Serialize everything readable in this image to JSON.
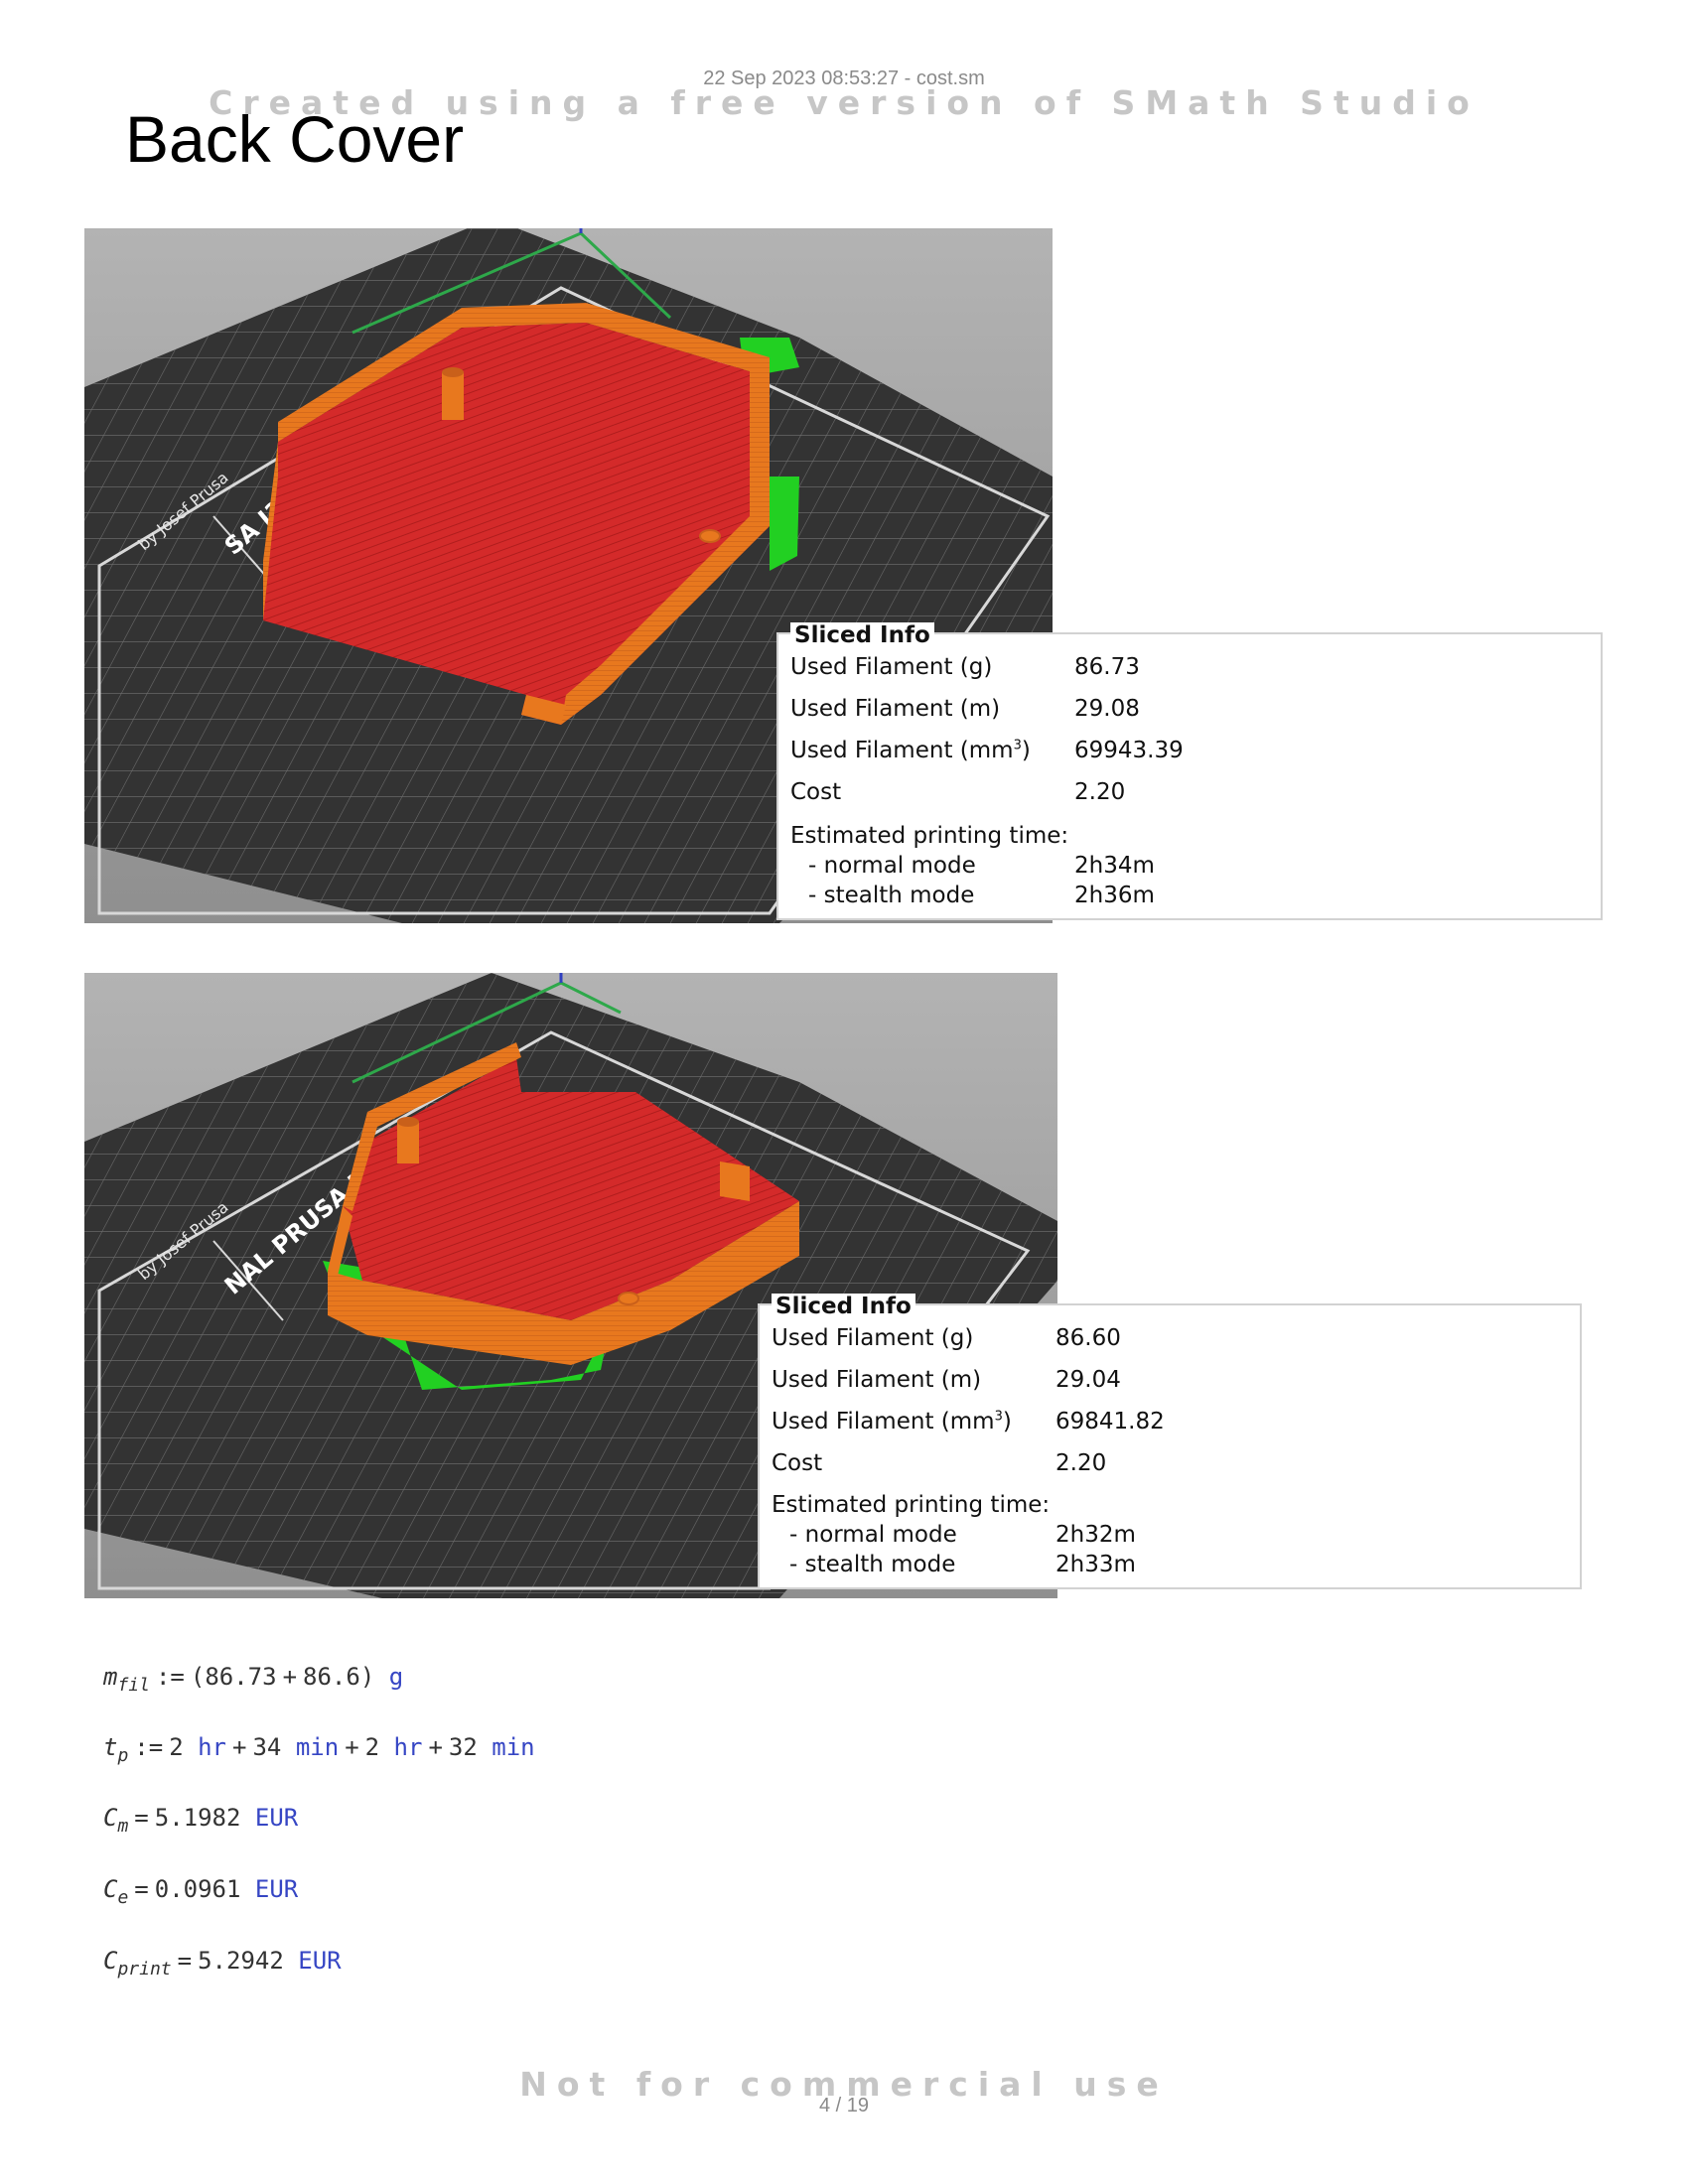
{
  "header": {
    "stamp": "22 Sep 2023 08:53:27 - cost.sm",
    "watermark_top": "Created using a free version of SMath Studio",
    "watermark_bottom": "Not for commercial use",
    "page_number": "4 / 19"
  },
  "title": "Back Cover",
  "slicer_shots": [
    {
      "bed_labels": [
        "SA I3 MK3",
        "by Josef Prusa"
      ],
      "info": {
        "title": "Sliced Info",
        "rows": [
          {
            "label": "Used Filament (g)",
            "value": "86.73"
          },
          {
            "label": "Used Filament (m)",
            "value": "29.08"
          },
          {
            "label": "Used Filament (mm",
            "sup": "3",
            "suffix": ")",
            "value": "69943.39"
          },
          {
            "label": "Cost",
            "value": "2.20"
          },
          {
            "label": "Estimated printing time:",
            "value": ""
          },
          {
            "label": "  - normal mode",
            "value": "2h34m"
          },
          {
            "label": "  - stealth mode",
            "value": "2h36m"
          }
        ]
      }
    },
    {
      "bed_labels": [
        "NAL PRUSA I3 MK3",
        "by Josef Prusa"
      ],
      "info": {
        "title": "Sliced Info",
        "rows": [
          {
            "label": "Used Filament (g)",
            "value": "86.60"
          },
          {
            "label": "Used Filament (m)",
            "value": "29.04"
          },
          {
            "label": "Used Filament (mm",
            "sup": "3",
            "suffix": ")",
            "value": "69841.82"
          },
          {
            "label": "Cost",
            "value": "2.20"
          },
          {
            "label": "Estimated printing time:",
            "value": ""
          },
          {
            "label": "  - normal mode",
            "value": "2h32m"
          },
          {
            "label": "  - stealth mode",
            "value": "2h33m"
          }
        ]
      }
    }
  ],
  "math": {
    "m_fil": {
      "sym": "m",
      "sub": "fil",
      "op": ":=",
      "open": "(",
      "a": "86.73",
      "plus": "+",
      "b": "86.6",
      "close": ")",
      "unit": "g"
    },
    "t_p": {
      "sym": "t",
      "sub": "p",
      "op": ":=",
      "h1": "2",
      "u_hr": "hr",
      "plus": "+",
      "m1": "34",
      "u_min": "min",
      "h2": "2",
      "m2": "32"
    },
    "C_m": {
      "sym": "C",
      "sub": "m",
      "op": "=",
      "value": "5.1982",
      "unit": "EUR"
    },
    "C_e": {
      "sym": "C",
      "sub": "e",
      "op": "=",
      "value": "0.0961",
      "unit": "EUR"
    },
    "C_print": {
      "sym": "C",
      "sub": "print",
      "op": "=",
      "value": "5.2942",
      "unit": "EUR"
    }
  },
  "colors": {
    "infill": "#d42a2a",
    "walls": "#e8781e",
    "support": "#22d022",
    "bed": "#333333",
    "unit_text": "#3646c4"
  }
}
